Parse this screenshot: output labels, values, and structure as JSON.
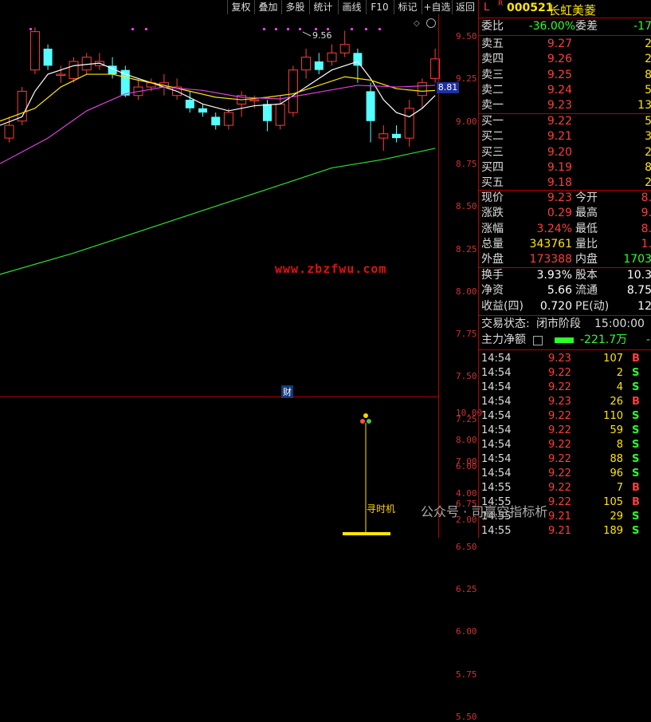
{
  "toolbar": {
    "buttons": [
      "复权",
      "叠加",
      "多股",
      "统计",
      "画线",
      "F10",
      "标记",
      "+自选",
      "返回"
    ]
  },
  "chart": {
    "price_axis": [
      "9.50",
      "9.25",
      "9.00",
      "8.75",
      "8.50",
      "8.25",
      "8.00",
      "7.75",
      "7.50",
      "7.25",
      "7.00",
      "6.75",
      "6.50",
      "6.25",
      "6.00",
      "5.75",
      "5.50"
    ],
    "current_price_tag": "8.81",
    "high_label": "9.56",
    "watermark": "www.zbzfwu.com",
    "finance_marker": "财",
    "indicator_axis": [
      "10.00",
      "8.00",
      "6.00",
      "4.00",
      "2.00"
    ],
    "indicator_label": "寻时机",
    "colors": {
      "up": "#ff3d3d",
      "down": "#5ff",
      "ma5": "#ffffff",
      "ma10": "#ffe600",
      "ma20": "#e040e0",
      "ma60": "#2ee02e"
    }
  },
  "panel": {
    "header_l": "L",
    "header_r": "R",
    "code": "000521",
    "name": "长虹美菱",
    "weibi_label": "委比",
    "weibi_value": "-36.00%",
    "weicha_label": "委差",
    "weicha_value": "-17",
    "asks": [
      {
        "label": "卖五",
        "price": "9.27",
        "vol": "2"
      },
      {
        "label": "卖四",
        "price": "9.26",
        "vol": "2"
      },
      {
        "label": "卖三",
        "price": "9.25",
        "vol": "8"
      },
      {
        "label": "卖二",
        "price": "9.24",
        "vol": "5"
      },
      {
        "label": "卖一",
        "price": "9.23",
        "vol": "13"
      }
    ],
    "bids": [
      {
        "label": "买一",
        "price": "9.22",
        "vol": "5"
      },
      {
        "label": "买二",
        "price": "9.21",
        "vol": "3"
      },
      {
        "label": "买三",
        "price": "9.20",
        "vol": "2"
      },
      {
        "label": "买四",
        "price": "9.19",
        "vol": "8"
      },
      {
        "label": "买五",
        "price": "9.18",
        "vol": "2"
      }
    ],
    "stats": [
      {
        "l1": "现价",
        "v1": "9.23",
        "c1": "red",
        "l2": "今开",
        "v2": "8.",
        "c2": "red"
      },
      {
        "l1": "涨跌",
        "v1": "0.29",
        "c1": "red",
        "l2": "最高",
        "v2": "9.",
        "c2": "red"
      },
      {
        "l1": "涨幅",
        "v1": "3.24%",
        "c1": "red",
        "l2": "最低",
        "v2": "8.",
        "c2": "red"
      },
      {
        "l1": "总量",
        "v1": "343761",
        "c1": "yellow",
        "l2": "量比",
        "v2": "1.",
        "c2": "red"
      },
      {
        "l1": "外盘",
        "v1": "173388",
        "c1": "red",
        "l2": "内盘",
        "v2": "1703",
        "c2": "green"
      }
    ],
    "stats2": [
      {
        "l1": "换手",
        "v1": "3.93%",
        "c1": "white",
        "l2": "股本",
        "v2": "10.3",
        "c2": "white"
      },
      {
        "l1": "净资",
        "v1": "5.66",
        "c1": "white",
        "l2": "流通",
        "v2": "8.75",
        "c2": "white"
      },
      {
        "l1": "收益(四)",
        "v1": "0.720",
        "c1": "white",
        "l2": "PE(动)",
        "v2": "12",
        "c2": "white"
      }
    ],
    "trade_status_label": "交易状态:",
    "trade_status_value": "闭市阶段",
    "trade_status_time": "15:00:00",
    "main_net_label": "主力净额",
    "main_net_value": "-221.7万",
    "main_net_suffix": "-",
    "trades": [
      {
        "time": "14:54",
        "price": "9.23",
        "vol": "107",
        "dir": "B"
      },
      {
        "time": "14:54",
        "price": "9.22",
        "vol": "2",
        "dir": "S"
      },
      {
        "time": "14:54",
        "price": "9.22",
        "vol": "4",
        "dir": "S"
      },
      {
        "time": "14:54",
        "price": "9.23",
        "vol": "26",
        "dir": "B"
      },
      {
        "time": "14:54",
        "price": "9.22",
        "vol": "110",
        "dir": "S"
      },
      {
        "time": "14:54",
        "price": "9.22",
        "vol": "59",
        "dir": "S"
      },
      {
        "time": "14:54",
        "price": "9.22",
        "vol": "8",
        "dir": "S"
      },
      {
        "time": "14:54",
        "price": "9.22",
        "vol": "88",
        "dir": "S"
      },
      {
        "time": "14:54",
        "price": "9.22",
        "vol": "96",
        "dir": "S"
      },
      {
        "time": "14:55",
        "price": "9.22",
        "vol": "7",
        "dir": "B"
      },
      {
        "time": "14:55",
        "price": "9.22",
        "vol": "105",
        "dir": "B"
      },
      {
        "time": "14:55",
        "price": "9.21",
        "vol": "29",
        "dir": "S"
      },
      {
        "time": "14:55",
        "price": "9.21",
        "vol": "189",
        "dir": "S"
      }
    ],
    "overlay_badge": "公众号 · 司赢空指标析"
  }
}
